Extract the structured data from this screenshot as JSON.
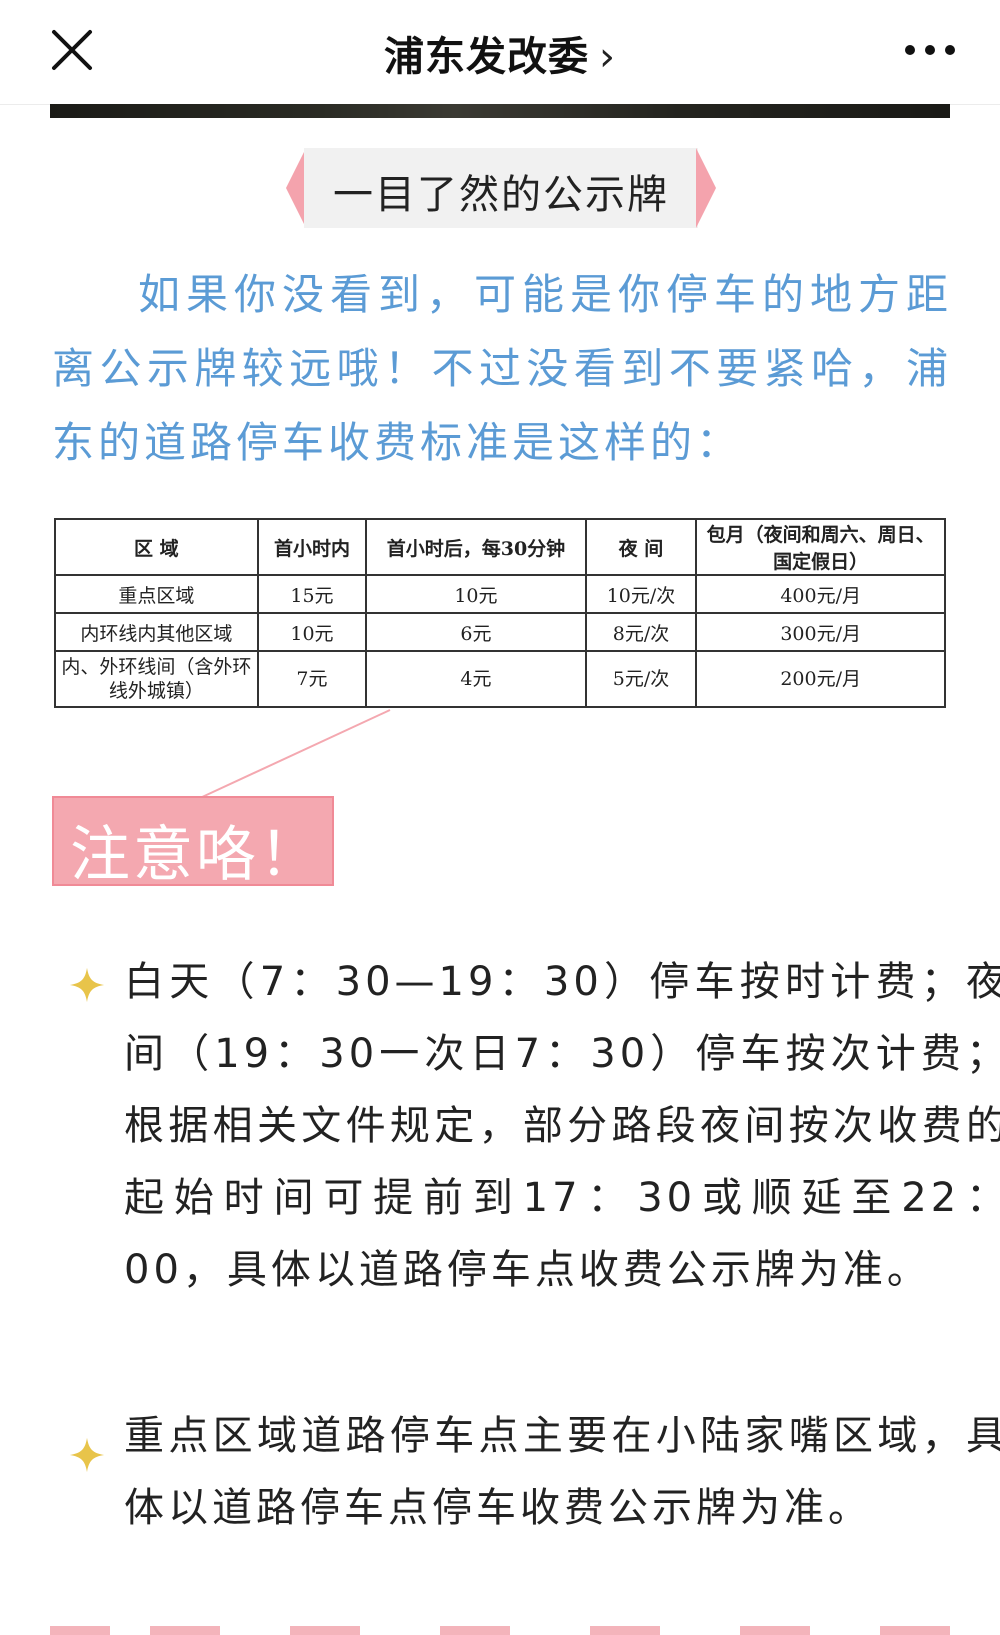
{
  "navbar": {
    "title": "浦东发改委",
    "chevron": "›",
    "close_icon": "close-icon",
    "more_icon": "more-dots-icon"
  },
  "banner": {
    "caption": "一目了然的公示牌"
  },
  "intro": {
    "text": "如果你没看到，可能是你停车的地方距离公示牌较远哦！不过没看到不要紧哈，浦东的道路停车收费标准是这样的："
  },
  "fee_table": {
    "headers": [
      "区 域",
      "首小时内",
      "首小时后，每30分钟",
      "夜 间",
      "包月（夜间和周六、周日、国定假日）"
    ],
    "rows": [
      [
        "重点区域",
        "15元",
        "10元",
        "10元/次",
        "400元/月"
      ],
      [
        "内环线内其他区域",
        "10元",
        "6元",
        "8元/次",
        "300元/月"
      ],
      [
        "内、外环线间（含外环线外城镇）",
        "7元",
        "4元",
        "5元/次",
        "200元/月"
      ]
    ]
  },
  "notice": {
    "label": "注意咯！"
  },
  "bullets": [
    {
      "icon": "sparkle-star-icon",
      "text": "白天（7：30—19：30）停车按时计费；夜间（19：30一次日7：30）停车按次计费；根据相关文件规定，部分路段夜间按次收费的起始时间可提前到17：30或顺延至22：00，具体以道路停车点收费公示牌为准。"
    },
    {
      "icon": "sparkle-star-icon",
      "text": "重点区域道路停车点主要在小陆家嘴区域，具体以道路停车点停车收费公示牌为准。"
    }
  ],
  "colors": {
    "intro_blue": "#5b9bd5",
    "accent_pink": "#f4a8b0",
    "star_gold": "#e8c44a"
  }
}
